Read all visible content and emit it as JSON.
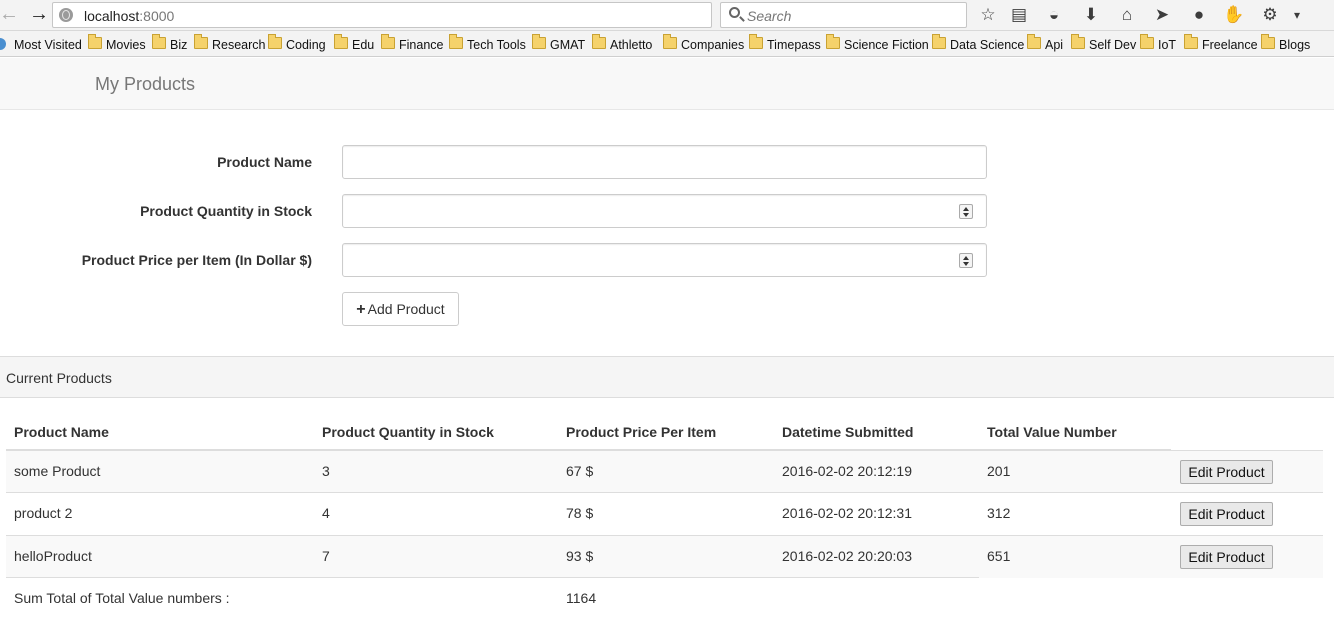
{
  "browser": {
    "url_host": "localhost",
    "url_port": ":8000",
    "search_placeholder": "Search"
  },
  "bookmarks": [
    "Most Visited",
    "Movies",
    "Biz",
    "Research",
    "Coding",
    "Edu",
    "Finance",
    "Tech Tools",
    "GMAT",
    "Athletto",
    "Companies",
    "Timepass",
    "Science Fiction",
    "Data Science",
    "Api",
    "Self Dev",
    "IoT",
    "Freelance",
    "Blogs"
  ],
  "app": {
    "brand": "My Products"
  },
  "form": {
    "name_label": "Product Name",
    "quantity_label": "Product Quantity in Stock",
    "price_label": "Product Price per Item (In Dollar $)",
    "name_value": "",
    "quantity_value": "",
    "price_value": "",
    "add_button_label": "Add Product"
  },
  "panel": {
    "title": "Current Products"
  },
  "table": {
    "headers": [
      "Product Name",
      "Product Quantity in Stock",
      "Product Price Per Item",
      "Datetime Submitted",
      "Total Value Number"
    ],
    "rows": [
      {
        "name": "some Product",
        "quantity": "3",
        "price": "67 $",
        "datetime": "2016-02-02 20:12:19",
        "total": "201",
        "action": "Edit Product"
      },
      {
        "name": "product 2",
        "quantity": "4",
        "price": "78 $",
        "datetime": "2016-02-02 20:12:31",
        "total": "312",
        "action": "Edit Product"
      },
      {
        "name": "helloProduct",
        "quantity": "7",
        "price": "93 $",
        "datetime": "2016-02-02 20:20:03",
        "total": "651",
        "action": "Edit Product"
      }
    ],
    "sum_label": "Sum Total of Total Value numbers :",
    "sum_value": "1164"
  }
}
